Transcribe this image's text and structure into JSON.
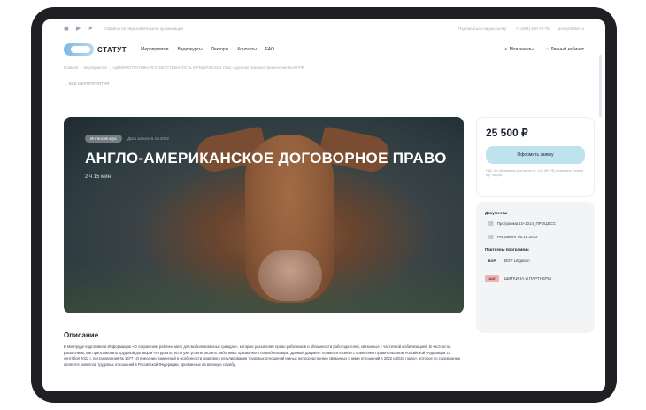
{
  "topbar": {
    "social_icons": [
      "vk-icon",
      "youtube-icon",
      "telegram-icon"
    ],
    "tagline": "Сервисы об образовательной организации",
    "right_links": [
      "Подписаться на рассылку",
      "+7 (499) 350-72-75",
      "post@statut.ru"
    ]
  },
  "header": {
    "logo": "СТАТУТ",
    "menu": [
      "Мероприятия",
      "Видеокурсы",
      "Лекторы",
      "Контакты",
      "FAQ"
    ],
    "my_orders": "Мои заказы",
    "cabinet": "Личный кабинет",
    "cart_count": "0"
  },
  "breadcrumb": "Главная  →  Мероприятия  →  АДМИНИСТРАТИВНАЯ ОТВЕТСТВЕННОСТЬ ЮРИДИЧЕСКИХ ЛИЦ: судебная практика применения КоАП РФ",
  "back_link": "← ВСЕ МЕРОПРИЯТИЯ",
  "hero": {
    "badge": "Интенсив курс",
    "date": "Дата записи 6.10.2022",
    "title": "АНГЛО-АМЕРИКАНСКОЕ ДОГОВОРНОЕ ПРАВО",
    "duration": "2 ч 15 мин"
  },
  "price_card": {
    "price": "25 500 ₽",
    "order_button": "Оформить заявку",
    "note": "НДС не облагается (согласно ст. 149 НК РФ) возможна оплата юр. лицом"
  },
  "documents": {
    "heading": "Документы",
    "items": [
      "Программа 10-1014_ПРОЦЕСС",
      "Регламент 05.10.2022"
    ]
  },
  "partners": {
    "heading": "Партнеры программы",
    "items": [
      {
        "logo": "BGP",
        "name": "BGP Litigation"
      },
      {
        "logo": "ШИ",
        "name": "ШИТКИНА И ПАРТНЕРЫ"
      }
    ]
  },
  "description": {
    "heading": "Описание",
    "text": "В Минтруде подготовили Информацию «О сохранении рабочих мест для мобилизованных граждан», которые разъясняет право работников и обязанности работодателей, связанные с частичной мобилизацией. В частности, разъяснили, как приостановить трудовой договор и что делать, если уже успели уволить работника, призванного по мобилизации. Данный документ появился в связи с принятием Правительством Российской Федерации 22 сентября 2022 г. постановления № 1677 «О внесении изменений в особенности правового регулирования трудовых отношений и иных непосредственно связанных с ними отношений в 2022 и 2023 годах», которое по содержанию является новеллой трудовых отношений в Российской Федерации, призванных на военную службу."
  },
  "colors": {
    "accent_button": "#bfe3ee",
    "text_dark": "#1c2330",
    "device_frame": "#1f2024"
  }
}
